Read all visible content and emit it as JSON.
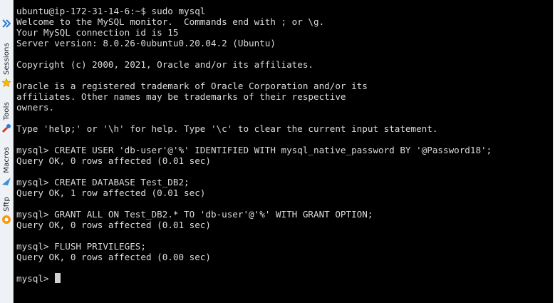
{
  "dock": {
    "items": [
      {
        "label": "Sessions",
        "icon": "star-icon"
      },
      {
        "label": "Tools",
        "icon": "tools-icon"
      },
      {
        "label": "Macros",
        "icon": "macros-icon"
      },
      {
        "label": "Sftp",
        "icon": "sftp-icon"
      }
    ]
  },
  "terminal": {
    "lines": [
      "ubuntu@ip-172-31-14-6:~$ sudo mysql",
      "Welcome to the MySQL monitor.  Commands end with ; or \\g.",
      "Your MySQL connection id is 15",
      "Server version: 8.0.26-0ubuntu0.20.04.2 (Ubuntu)",
      "",
      "Copyright (c) 2000, 2021, Oracle and/or its affiliates.",
      "",
      "Oracle is a registered trademark of Oracle Corporation and/or its",
      "affiliates. Other names may be trademarks of their respective",
      "owners.",
      "",
      "Type 'help;' or '\\h' for help. Type '\\c' to clear the current input statement.",
      "",
      "mysql> CREATE USER 'db-user'@'%' IDENTIFIED WITH mysql_native_password BY '@Password18';",
      "Query OK, 0 rows affected (0.01 sec)",
      "",
      "mysql> CREATE DATABASE Test_DB2;",
      "Query OK, 1 row affected (0.01 sec)",
      "",
      "mysql> GRANT ALL ON Test_DB2.* TO 'db-user'@'%' WITH GRANT OPTION;",
      "Query OK, 0 rows affected (0.01 sec)",
      "",
      "mysql> FLUSH PRIVILEGES;",
      "Query OK, 0 rows affected (0.00 sec)",
      ""
    ],
    "prompt": "mysql> "
  },
  "colors": {
    "terminal_bg": "#000000",
    "terminal_fg": "#dcdcdc",
    "dock_bg": "#eef2f7",
    "accent_blue": "#2e7bcf"
  }
}
